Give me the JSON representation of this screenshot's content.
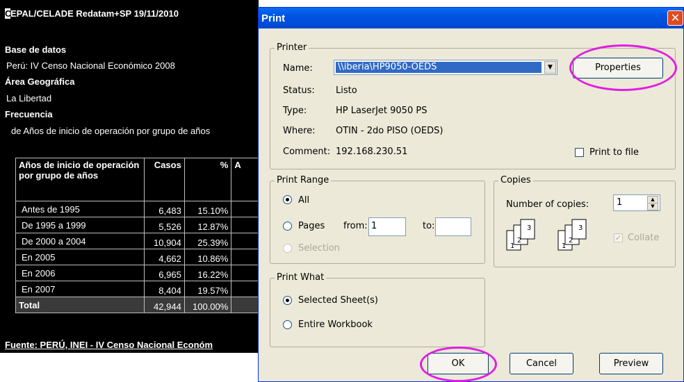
{
  "report": {
    "title_cursor": "C",
    "title_rest": "EPAL/CELADE Redatam+SP 19/11/2010",
    "database_heading": "Base de datos",
    "database_value": "Perú: IV Censo Nacional Económico 2008",
    "area_heading": "Área Geográfica",
    "area_value": "La Libertad",
    "frequency_heading": "Frecuencia",
    "frequency_value": "de Años de inicio de operación por grupo de años",
    "table": {
      "col_label": "Años de inicio de operación por grupo de años",
      "col_cases": "Casos",
      "col_pct": "%",
      "col_cut": "A",
      "rows": [
        {
          "label": "Antes de 1995",
          "cases": "6,483",
          "pct": "15.10%"
        },
        {
          "label": "De 1995 a 1999",
          "cases": "5,526",
          "pct": "12.87%"
        },
        {
          "label": "De 2000 a 2004",
          "cases": "10,904",
          "pct": "25.39%"
        },
        {
          "label": "En 2005",
          "cases": "4,662",
          "pct": "10.86%"
        },
        {
          "label": "En 2006",
          "cases": "6,965",
          "pct": "16.22%"
        },
        {
          "label": "En 2007",
          "cases": "8,404",
          "pct": "19.57%"
        }
      ],
      "total": {
        "label": "Total",
        "cases": "42,944",
        "pct": "100.00%"
      }
    },
    "footer": "Fuente: PERÚ, INEI - IV Censo Nacional Económ"
  },
  "dialog": {
    "title": "Print",
    "close_glyph": "✕",
    "printer": {
      "legend": "Printer",
      "name_label": "Name:",
      "name_value": "\\\\iberia\\HP9050-OEDS",
      "properties_label": "Properties",
      "status_label": "Status:",
      "status_value": "Listo",
      "type_label": "Type:",
      "type_value": "HP LaserJet 9050 PS",
      "where_label": "Where:",
      "where_value": "OTIN - 2do PISO (OEDS)",
      "comment_label": "Comment:",
      "comment_value": "192.168.230.51",
      "print_to_file_label": "Print to file"
    },
    "range": {
      "legend": "Print Range",
      "all_label": "All",
      "pages_label": "Pages",
      "from_label": "from:",
      "from_value": "1",
      "to_label": "to:",
      "to_value": "",
      "selection_label": "Selection"
    },
    "copies": {
      "legend": "Copies",
      "number_label": "Number of copies:",
      "number_value": "1",
      "collate_label": "Collate",
      "collate_check": "✓"
    },
    "what": {
      "legend": "Print What",
      "selected_label": "Selected Sheet(s)",
      "workbook_label": "Entire Workbook"
    },
    "buttons": {
      "ok": "OK",
      "cancel": "Cancel",
      "preview": "Preview"
    }
  },
  "colors": {
    "highlight_ellipse": "#e11ee1",
    "titlebar": "#0054e3",
    "dialog_bg": "#ece9d8"
  }
}
